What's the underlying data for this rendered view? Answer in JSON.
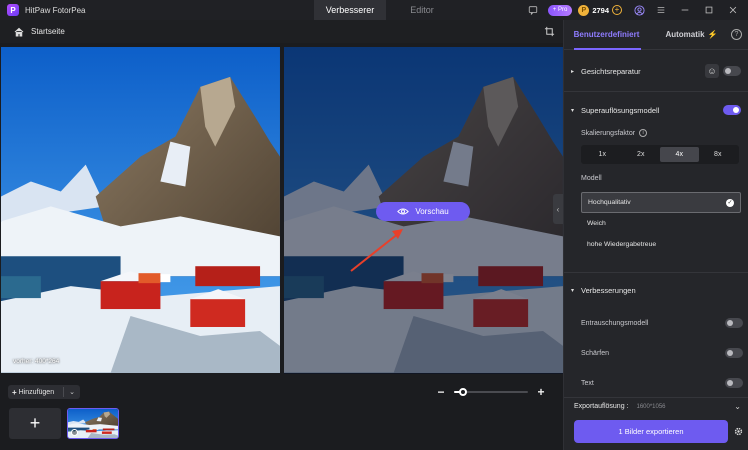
{
  "app": {
    "name": "HitPaw FotorPea"
  },
  "mode_tabs": [
    "Verbesserer",
    "Editor"
  ],
  "account": {
    "pro_label": "+ Pro",
    "coins": "2794"
  },
  "breadcrumb": {
    "home_label": "Startseite"
  },
  "preview": {
    "before_size_label": "vorher: 400*264",
    "preview_button": "Vorschau"
  },
  "bottom": {
    "add_label": "Hinzufügen",
    "zoom_level": 0.12
  },
  "panel": {
    "tabs": {
      "custom": "Benutzerdefiniert",
      "auto": "Automatik"
    },
    "face_repair": {
      "label": "Gesichtsreparatur",
      "enabled": false
    },
    "super_res": {
      "label": "Superauflösungsmodell",
      "enabled": true,
      "scale_label": "Skalierungsfaktor",
      "scale_options": [
        "1x",
        "2x",
        "4x",
        "8x"
      ],
      "scale_selected": "4x",
      "model_label": "Modell",
      "models": [
        "Hochqualitativ",
        "Weich",
        "hohe Wiedergabetreue"
      ],
      "model_selected": "Hochqualitativ"
    },
    "enhancements": {
      "label": "Verbesserungen",
      "items": [
        {
          "label": "Entrauschungsmodell",
          "enabled": false
        },
        {
          "label": "Schärfen",
          "enabled": false
        },
        {
          "label": "Text",
          "enabled": false
        }
      ]
    },
    "export_resolution": {
      "label": "Exportauflösung :",
      "value": "1600*1056"
    },
    "export_button": "1 Bilder exportieren"
  },
  "colors": {
    "accent": "#6e5bf0",
    "coin": "#f0b23a",
    "panel_bg": "#25262a"
  },
  "icons": [
    "app-logo-icon",
    "feedback-icon",
    "coin-icon",
    "user-icon",
    "menu-icon",
    "minimize-icon",
    "maximize-icon",
    "close-icon",
    "home-icon",
    "crop-icon",
    "eye-icon",
    "face-icon",
    "info-icon",
    "check-icon",
    "gear-icon"
  ]
}
